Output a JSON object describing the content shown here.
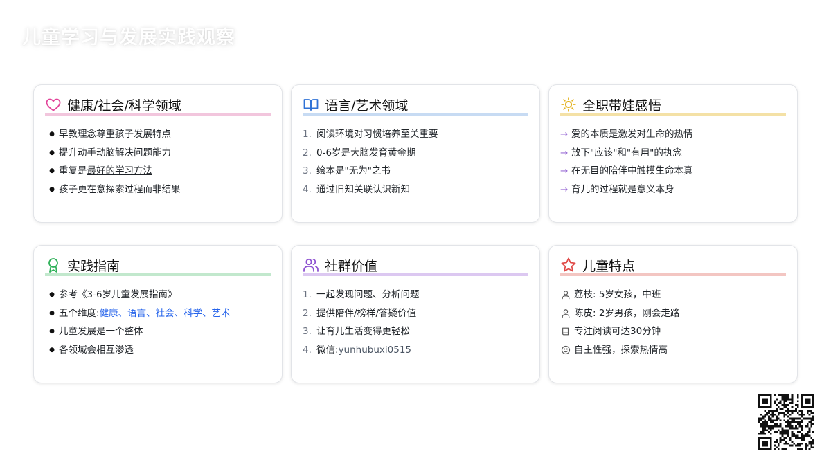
{
  "page": {
    "title": "儿童学习与发展实践观察"
  },
  "cards": [
    {
      "title": "健康/社会/科学领域",
      "icon": "heart-icon",
      "accent": "#e2449a",
      "underline": "#f2c6dd",
      "items": [
        {
          "text": "早教理念尊重孩子发展特点"
        },
        {
          "text": "提升动手动脑解决问题能力"
        },
        {
          "prefix": "重复是",
          "emph": "最好的学习方法"
        },
        {
          "text": "孩子更在意探索过程而非结果"
        }
      ]
    },
    {
      "title": "语言/艺术领域",
      "icon": "open-book-icon",
      "accent": "#2f72d6",
      "underline": "#c7dbf3",
      "items": [
        {
          "num": "1.",
          "text": "阅读环境对习惯培养至关重要"
        },
        {
          "num": "2.",
          "text": "0-6岁是大脑发育黄金期"
        },
        {
          "num": "3.",
          "text": "绘本是\"无为\"之书"
        },
        {
          "num": "4.",
          "text": "通过旧知关联认识新知"
        }
      ]
    },
    {
      "title": "全职带娃感悟",
      "icon": "sun-icon",
      "accent": "#e3b21f",
      "underline": "#f4e1a6",
      "items": [
        {
          "arrow": "→",
          "text": "爱的本质是激发对生命的热情"
        },
        {
          "arrow": "→",
          "text": "放下\"应该\"和\"有用\"的执念"
        },
        {
          "arrow": "→",
          "text": "在无目的陪伴中触摸生命本真"
        },
        {
          "arrow": "→",
          "text": "育儿的过程就是意义本身"
        }
      ]
    },
    {
      "title": "实践指南",
      "icon": "award-icon",
      "accent": "#2fb159",
      "underline": "#c2e8cd",
      "items": [
        {
          "text": "参考《3-6岁儿童发展指南》"
        },
        {
          "prefix": "五个维度: ",
          "link": "健康、语言、社会、科学、艺术"
        },
        {
          "text": "儿童发展是一个整体"
        },
        {
          "text": "各领域会相互渗透"
        }
      ]
    },
    {
      "title": "社群价值",
      "icon": "users-icon",
      "accent": "#8e52d1",
      "underline": "#dcc8f1",
      "items": [
        {
          "num": "1.",
          "text": "一起发现问题、分析问题"
        },
        {
          "num": "2.",
          "text": "提供陪伴/榜样/答疑价值"
        },
        {
          "num": "3.",
          "text": "让育儿生活变得更轻松"
        },
        {
          "num": "4.",
          "prefix": "微信: ",
          "grey": "yunhubuxi0515"
        }
      ]
    },
    {
      "title": "儿童特点",
      "icon": "star-icon",
      "accent": "#e04a48",
      "underline": "#f3c6c2",
      "items": [
        {
          "icon": "person-icon",
          "text": "荔枝: 5岁女孩，中班"
        },
        {
          "icon": "person-icon",
          "text": "陈皮: 2岁男孩，刚会走路"
        },
        {
          "icon": "book-icon",
          "text": "专注阅读可达30分钟"
        },
        {
          "icon": "smile-icon",
          "text": "自主性强，探索热情高"
        }
      ]
    }
  ],
  "qr": {
    "icon": "qr-code-icon"
  }
}
